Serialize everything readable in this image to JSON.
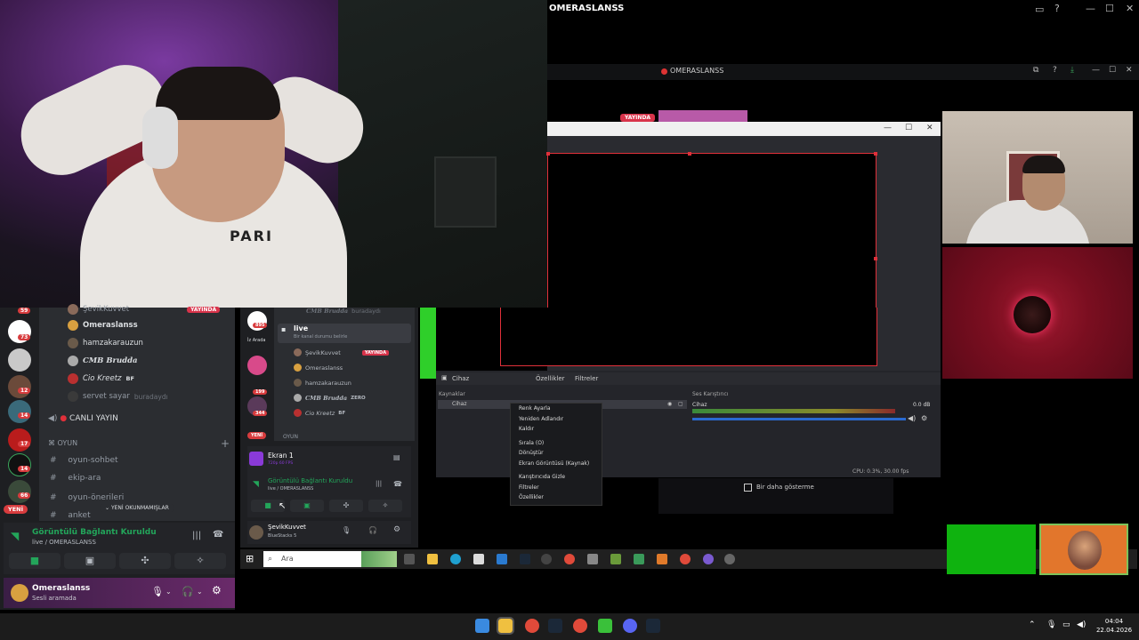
{
  "remote_window": {
    "title": "OMERASLANSS"
  },
  "stream_window": {
    "title": "OMERASLANSS",
    "live_badge": "YAYINDA"
  },
  "webcam": {
    "shirt_text": "PARI"
  },
  "obs": {
    "canvas_source": "Cihaz",
    "properties_label": "Özellikler",
    "filters_label": "Filtreler",
    "sources_title": "Kaynaklar",
    "source_item": "Cihaz",
    "mixer_title": "Ses Karıştırıcı",
    "mixer_item": "Cihaz",
    "mixer_db": "0.0 dB",
    "cpu_status": "CPU: 0.3%, 30.00 fps",
    "context_menu": [
      "Renk Ayarla",
      "Yeniden Adlandır",
      "Kaldır",
      "Sırala (O)",
      "Dönüştür",
      "Ekran Görüntüsü (Kaynak)",
      "Karıştırıcıda Gizle",
      "Filtreler",
      "Özellikler"
    ],
    "dont_show": "Bir daha gösterme"
  },
  "discord_left": {
    "server_badges": [
      "59",
      "73",
      "12",
      "14",
      "17",
      "14",
      "66"
    ],
    "new_label": "YENİ",
    "voice_users": [
      {
        "name": "ŞevikKuvvet",
        "badge": "YAYINDA"
      },
      {
        "name": "Omeraslanss"
      },
      {
        "name": "hamzakarauzun"
      },
      {
        "name": "CMB Brudda"
      },
      {
        "name": "Cio Kreetz",
        "tag": "BF"
      },
      {
        "name": "servet sayar",
        "suffix": "buradaydı"
      }
    ],
    "live_channel": "CANLI YAYIN",
    "category": "OYUN",
    "channels": [
      "oyun-sohbet",
      "ekip-ara",
      "oyun-önerileri",
      "anket"
    ],
    "unread_pill": "YENİ OKUNMAMIŞLAR",
    "voice_status": "Görüntülü Bağlantı Kuruldu",
    "voice_sub": "live / OMERASLANSS",
    "user_name": "Omeraslanss",
    "user_status": "Sesli aramada"
  },
  "discord_mid": {
    "top_line": "CMB Brudda",
    "top_line_suffix": "buradaydı",
    "server_badges": [
      "895",
      "199",
      "344"
    ],
    "server_label": "İz Arada",
    "new_label": "YENİ",
    "channel_name": "live",
    "channel_hint": "Bir kanal durumu belirle",
    "users": [
      {
        "name": "ŞevikKuvvet",
        "badge": "YAYINDA"
      },
      {
        "name": "Omeraslanss"
      },
      {
        "name": "hamzakarauzun"
      },
      {
        "name": "CMB Brudda",
        "tag": "ZERO"
      },
      {
        "name": "Cio Kreetz",
        "tag": "BF"
      }
    ],
    "category": "OYUN",
    "stream_title": "Ekran 1",
    "stream_sub": "720p 60 FPS",
    "voice_status": "Görüntülü Bağlantı Kuruldu",
    "voice_sub": "live / OMERASLANSS",
    "user_name": "ŞevikKuvvet",
    "user_status": "BlueStacks 5"
  },
  "inner_taskbar": {
    "search_placeholder": "Ara"
  },
  "clock": {
    "time": "04:04",
    "date": "22.04.2026"
  }
}
